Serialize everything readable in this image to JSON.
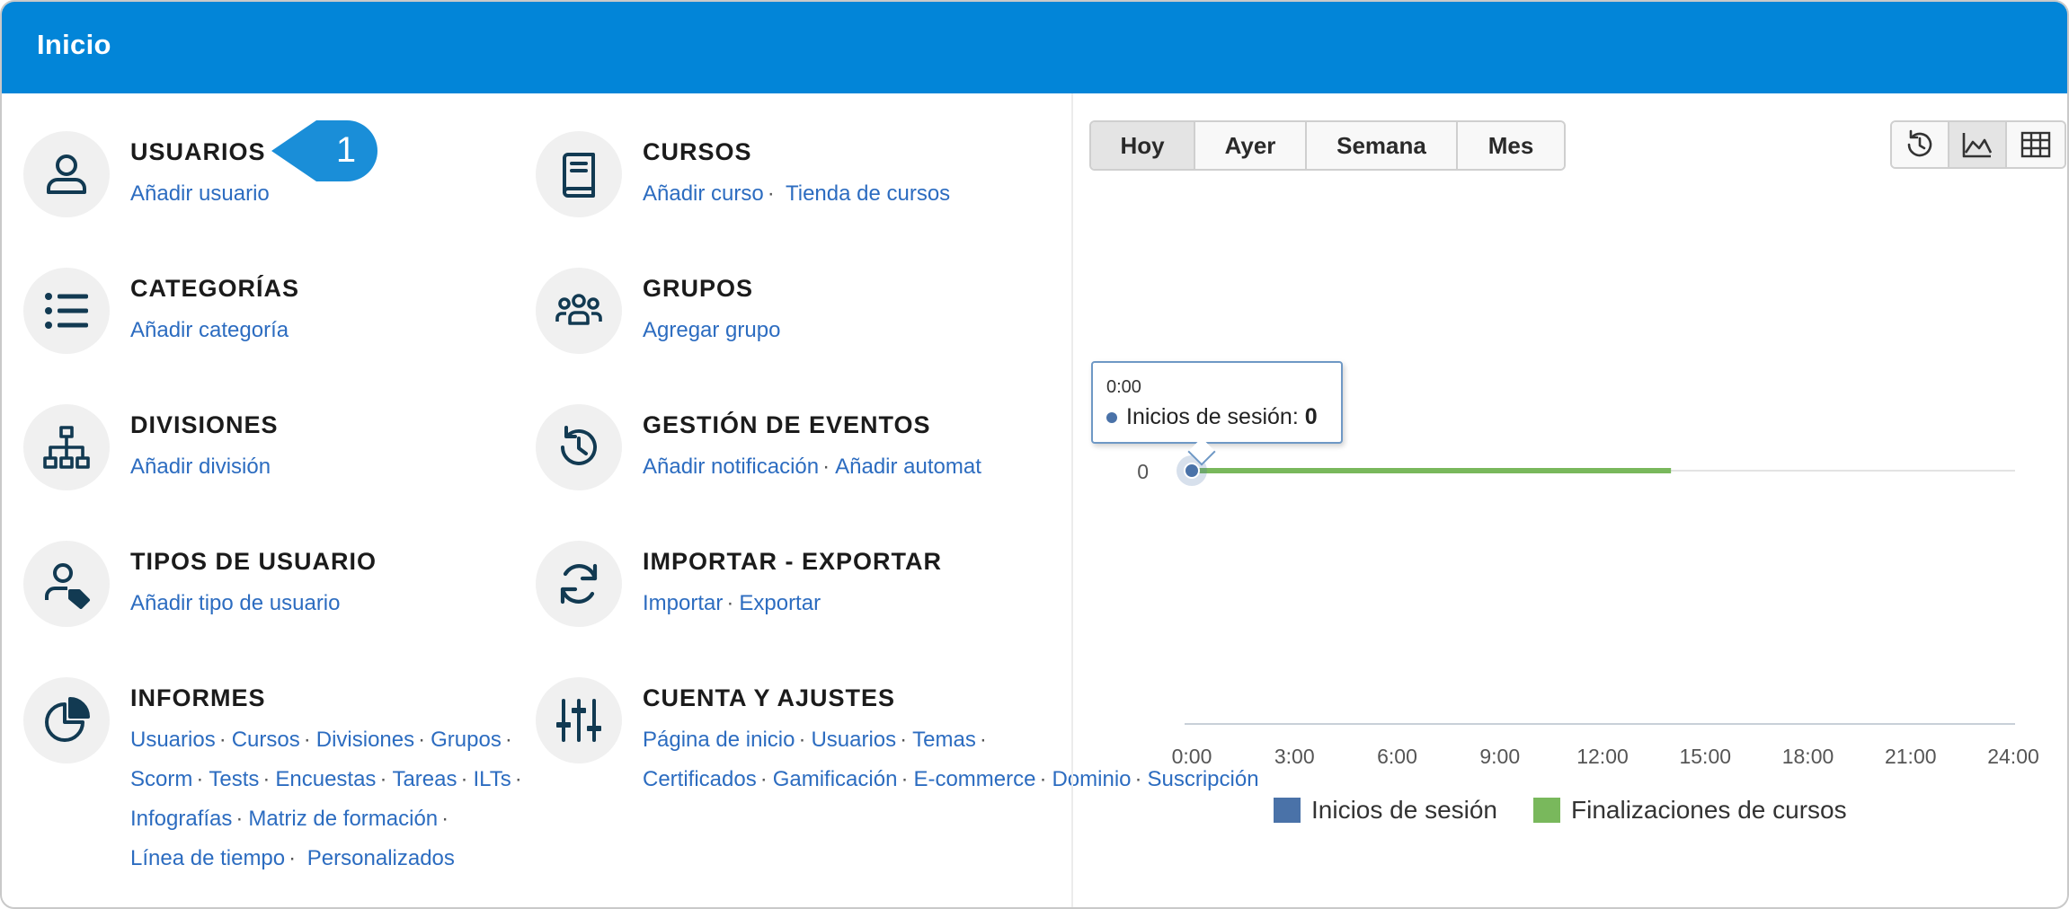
{
  "header": {
    "title": "Inicio"
  },
  "callout": {
    "number": "1"
  },
  "sections": {
    "usuarios": {
      "title": "USUARIOS",
      "links": [
        "Añadir usuario"
      ]
    },
    "cursos": {
      "title": "CURSOS",
      "links": [
        "Añadir curso",
        "Tienda de cursos"
      ]
    },
    "categorias": {
      "title": "CATEGORÍAS",
      "links": [
        "Añadir categoría"
      ]
    },
    "grupos": {
      "title": "GRUPOS",
      "links": [
        "Agregar grupo"
      ]
    },
    "divisiones": {
      "title": "DIVISIONES",
      "links": [
        "Añadir división"
      ]
    },
    "eventos": {
      "title": "GESTIÓN DE EVENTOS",
      "links": [
        "Añadir notificación",
        "Añadir automat"
      ]
    },
    "tipos": {
      "title": "TIPOS DE USUARIO",
      "links": [
        "Añadir tipo de usuario"
      ]
    },
    "importar": {
      "title": "IMPORTAR - EXPORTAR",
      "links": [
        "Importar",
        "Exportar"
      ]
    },
    "informes": {
      "title": "INFORMES",
      "links": [
        "Usuarios",
        "Cursos",
        "Divisiones",
        "Grupos",
        "Scorm",
        "Tests",
        "Encuestas",
        "Tareas",
        "ILTs",
        "Infografías",
        "Matriz de formación",
        "Línea de tiempo",
        "Personalizados"
      ]
    },
    "cuenta": {
      "title": "CUENTA Y AJUSTES",
      "links": [
        "Página de inicio",
        "Usuarios",
        "Temas",
        "Certificados",
        "Gamificación",
        "E-commerce",
        "Dominio",
        "Suscripción"
      ]
    }
  },
  "period_tabs": [
    {
      "label": "Hoy",
      "active": true
    },
    {
      "label": "Ayer",
      "active": false
    },
    {
      "label": "Semana",
      "active": false
    },
    {
      "label": "Mes",
      "active": false
    }
  ],
  "view_buttons": [
    {
      "icon": "history-icon",
      "active": false
    },
    {
      "icon": "area-chart-icon",
      "active": true
    },
    {
      "icon": "table-grid-icon",
      "active": false
    }
  ],
  "tooltip": {
    "time": "0:00",
    "series": "Inicios de sesión",
    "value": "0"
  },
  "colors": {
    "header": "#0285d8",
    "link": "#2c6cc0",
    "series_logins": "#4a72a8",
    "series_completions": "#79b85c"
  },
  "chart_data": {
    "type": "line",
    "x_ticks": [
      "0:00",
      "3:00",
      "6:00",
      "9:00",
      "12:00",
      "15:00",
      "18:00",
      "21:00",
      "24:00"
    ],
    "y_ticks": [
      "0"
    ],
    "series": [
      {
        "name": "Inicios de sesión",
        "x": [
          "0:00"
        ],
        "values": [
          0
        ],
        "color": "#4a72a8"
      },
      {
        "name": "Finalizaciones de cursos",
        "x": [
          "0:00",
          "14:00"
        ],
        "values": [
          0,
          0
        ],
        "color": "#79b85c"
      }
    ],
    "legend_position": "bottom",
    "grid": true
  }
}
